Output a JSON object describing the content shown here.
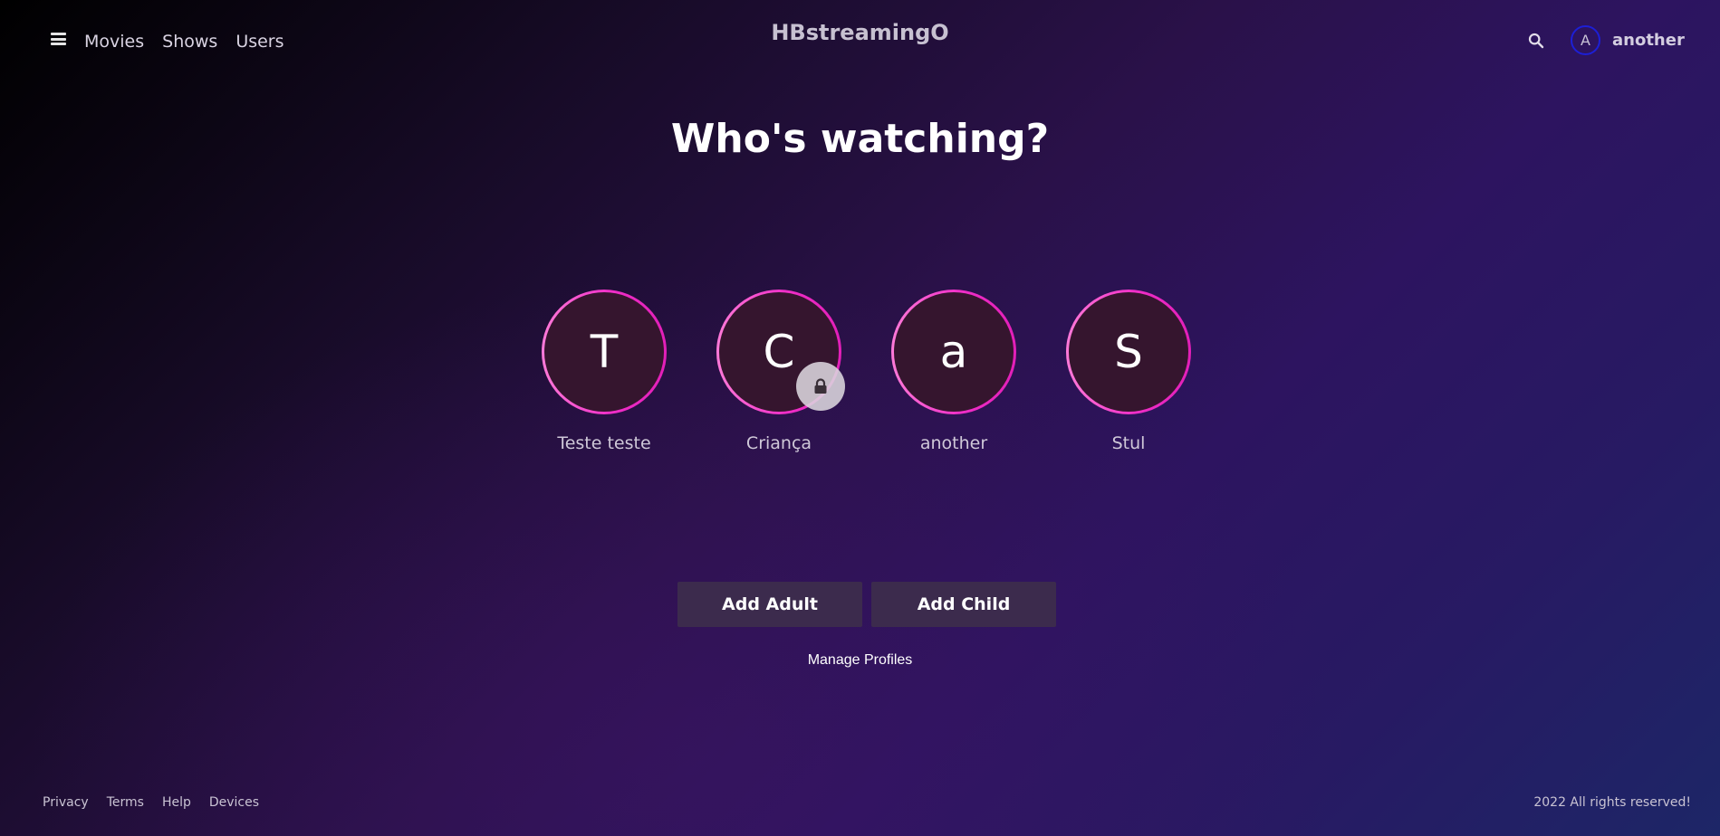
{
  "header": {
    "brand": "HBstreamingO",
    "nav": [
      {
        "label": "Movies"
      },
      {
        "label": "Shows"
      },
      {
        "label": "Users"
      }
    ],
    "user": {
      "initial": "A",
      "name": "another"
    }
  },
  "main": {
    "title": "Who's watching?",
    "profiles": [
      {
        "initial": "T",
        "name": "Teste teste",
        "locked": false
      },
      {
        "initial": "C",
        "name": "Criança",
        "locked": true
      },
      {
        "initial": "a",
        "name": "another",
        "locked": false
      },
      {
        "initial": "S",
        "name": "Stul",
        "locked": false
      }
    ],
    "add_adult_label": "Add Adult",
    "add_child_label": "Add Child",
    "manage_label": "Manage Profiles"
  },
  "footer": {
    "links": [
      {
        "label": "Privacy"
      },
      {
        "label": "Terms"
      },
      {
        "label": "Help"
      },
      {
        "label": "Devices"
      }
    ],
    "copyright": "2022 All rights reserved!"
  },
  "colors": {
    "profile_ring": "#f02fc8",
    "profile_fill": "#35152e",
    "button_bg": "#3c2b4d",
    "avatar_ring": "#1d1fd6"
  },
  "icons": {
    "menu": "hamburger-icon",
    "search": "search-icon",
    "lock": "lock-icon"
  }
}
